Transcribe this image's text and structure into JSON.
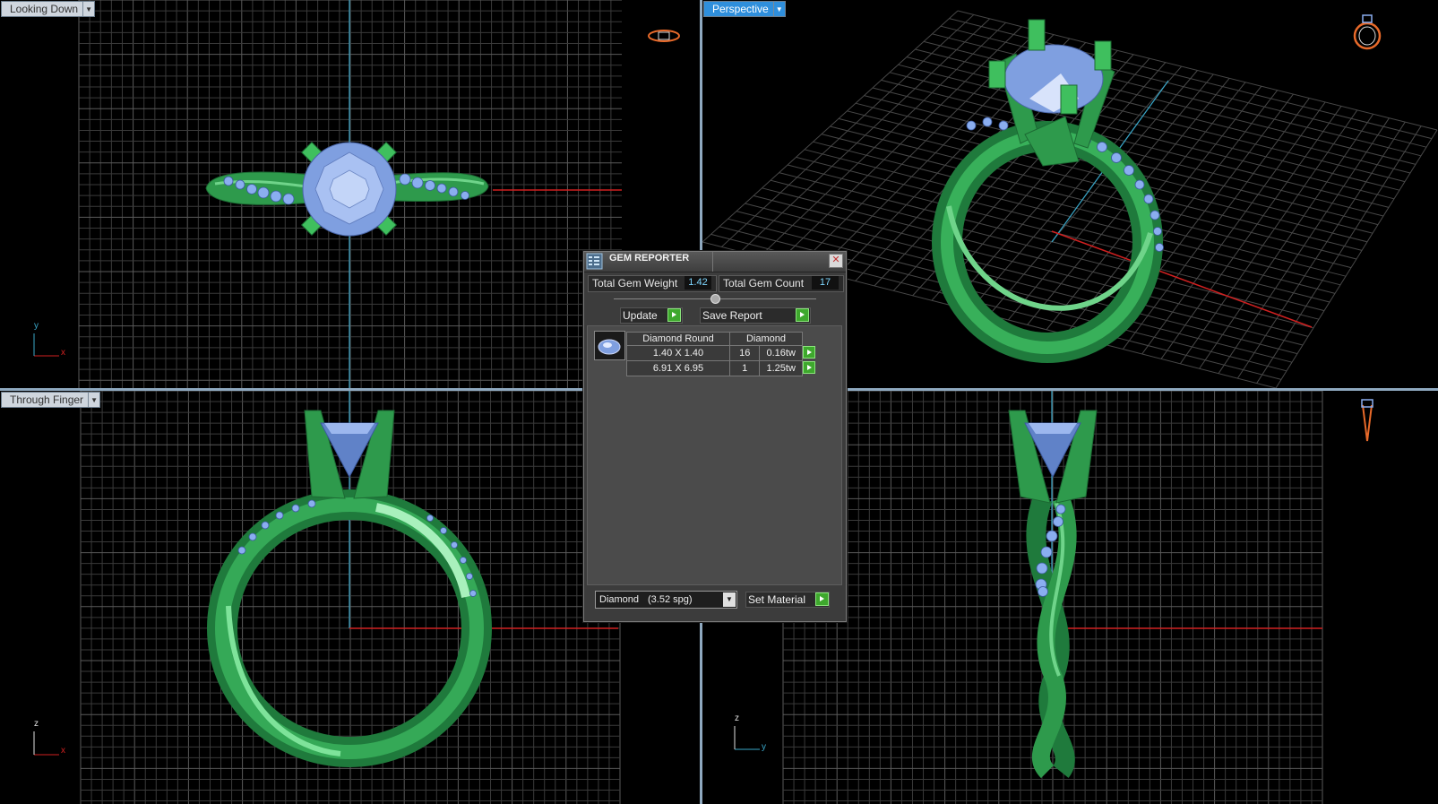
{
  "viewports": {
    "top_left": {
      "label": "Looking Down",
      "axis_v": "y",
      "axis_h": "x"
    },
    "top_right": {
      "label": "Perspective"
    },
    "bottom_left": {
      "label": "Through Finger",
      "axis_v": "z",
      "axis_h": "x"
    },
    "bottom_right": {
      "axis_v": "z",
      "axis_h": "y"
    }
  },
  "gem_reporter": {
    "title": "GEM REPORTER",
    "close_glyph": "✕",
    "total_weight_label": "Total Gem Weight",
    "total_weight_value": "1.42",
    "total_count_label": "Total Gem Count",
    "total_count_value": "17",
    "update_label": "Update",
    "save_report_label": "Save Report",
    "table": {
      "headers": [
        "Diamond Round",
        "Diamond"
      ],
      "rows": [
        {
          "size": "1.40 X 1.40",
          "count": "16",
          "weight": "0.16tw"
        },
        {
          "size": "6.91 X 6.95",
          "count": "1",
          "weight": "1.25tw"
        }
      ]
    },
    "material_select": {
      "value": "Diamond",
      "spg": "(3.52 spg)"
    },
    "set_material_label": "Set Material"
  },
  "colors": {
    "metal": "#2e9a4c",
    "gem": "#7f9fe0",
    "grid": "#3a3a3a",
    "axis_red": "#d02020",
    "axis_cyan": "#3aa7c9",
    "active_label": "#2f8fdc"
  },
  "icons": [
    "view-cube-top-icon",
    "view-cube-perspective-icon",
    "view-cube-side-icon",
    "gem-reporter-icon",
    "close-icon",
    "dropdown-arrow-icon",
    "play-icon"
  ]
}
